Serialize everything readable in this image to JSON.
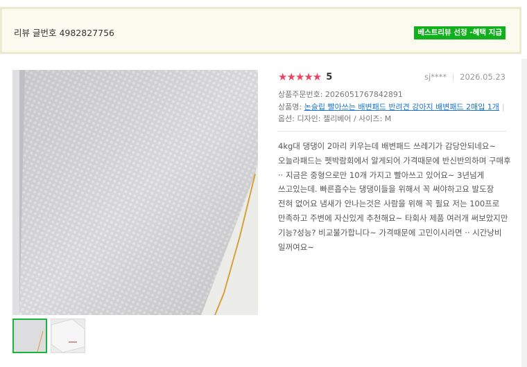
{
  "header": {
    "review_number": "리뷰 글번호 4982827756",
    "best_badge": "베스트리뷰 선정 -혜택 지급"
  },
  "review": {
    "stars": "★★★★★",
    "score": "5",
    "rating_value": 5,
    "rating_max": 5,
    "user": "sj****",
    "date": "2026.05.23",
    "order_number": "상품주문번호: 2026051767842891",
    "product_label": "상품명:",
    "product_name": "논슬립 빨아쓰는 배변패드 반려견 강아지 배변패드 2매입 1개",
    "option": "옵션: 디자인: 젤리베어 / 사이즈: M",
    "text": "4kg대 댕댕이 2마리 키우는데 배변패드 쓰레기가 감당안되네요~ 오늘라패드는 펫박람회에서 알게되어 가격때문에 반신반의하며 구매후 ·· 지금은 중형으로만 10개 가지고 빨아쓰고 있어요~ 3년넘게 쓰고있는데. 빠른흡수는 댕댕이들을 위해서 꼭 써야하고요 발도장 전혀 없어요 냄새가 안나는것은 사람을 위해 꼭 필요 저는 100프로 만족하고 주변에 자신있게 추천해요~ 타회사 제품 여러개 써보았지만 기능?성능? 비교불가합니다~ 가격때문에 고민이시라면 ·· 시간낭비 일꺼여요~"
  },
  "colors": {
    "star": "#f0435b",
    "badge": "#11b11d",
    "link": "#1a76d2",
    "thumb_selected": "#1bb53c"
  },
  "photos": {
    "main": "pad-photo",
    "thumbnails": [
      "pad-photo",
      "pad-package-photo"
    ],
    "selected_index": 0
  }
}
